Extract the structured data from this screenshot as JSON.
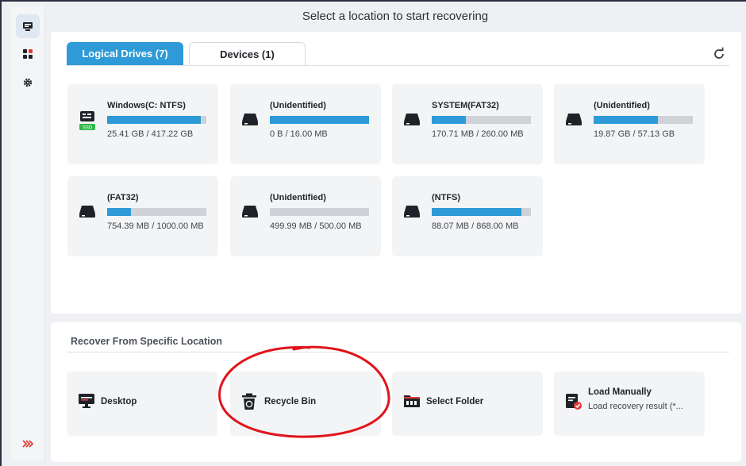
{
  "header": {
    "title": "Select a location to start recovering"
  },
  "sidebar": {
    "items": [
      {
        "icon": "drive-icon",
        "active": true
      },
      {
        "icon": "apps-icon",
        "active": false
      },
      {
        "icon": "gear-icon",
        "active": false
      }
    ],
    "bottom_icon": "expand-chevrons-icon"
  },
  "tabs": [
    {
      "label": "Logical Drives (7)",
      "active": true
    },
    {
      "label": "Devices (1)",
      "active": false
    }
  ],
  "drives": [
    {
      "name": "Windows(C: NTFS)",
      "size": "25.41 GB / 417.22 GB",
      "used_fraction": 0.94,
      "badge": "SSD"
    },
    {
      "name": "(Unidentified)",
      "size": "0 B / 16.00 MB",
      "used_fraction": 1.0
    },
    {
      "name": "SYSTEM(FAT32)",
      "size": "170.71 MB / 260.00 MB",
      "used_fraction": 0.34
    },
    {
      "name": "(Unidentified)",
      "size": "19.87 GB / 57.13 GB",
      "used_fraction": 0.65
    },
    {
      "name": "(FAT32)",
      "size": "754.39 MB / 1000.00 MB",
      "used_fraction": 0.24
    },
    {
      "name": "(Unidentified)",
      "size": "499.99 MB / 500.00 MB",
      "used_fraction": 0.0
    },
    {
      "name": "(NTFS)",
      "size": "88.07 MB / 868.00 MB",
      "used_fraction": 0.9
    }
  ],
  "specific": {
    "title": "Recover From Specific Location",
    "items": [
      {
        "label": "Desktop",
        "icon": "desktop-icon"
      },
      {
        "label": "Recycle Bin",
        "icon": "recycle-bin-icon"
      },
      {
        "label": "Select Folder",
        "icon": "folder-icon"
      },
      {
        "label": "Load Manually",
        "sub": "Load recovery result (*...",
        "icon": "load-manually-icon"
      }
    ]
  },
  "colors": {
    "accent": "#2e9ad7",
    "bar_bg": "#cfd2d6",
    "annotation": "#e0141b",
    "ssd_badge": "#2fb84a",
    "load_icon_accent": "#e43a3a"
  }
}
